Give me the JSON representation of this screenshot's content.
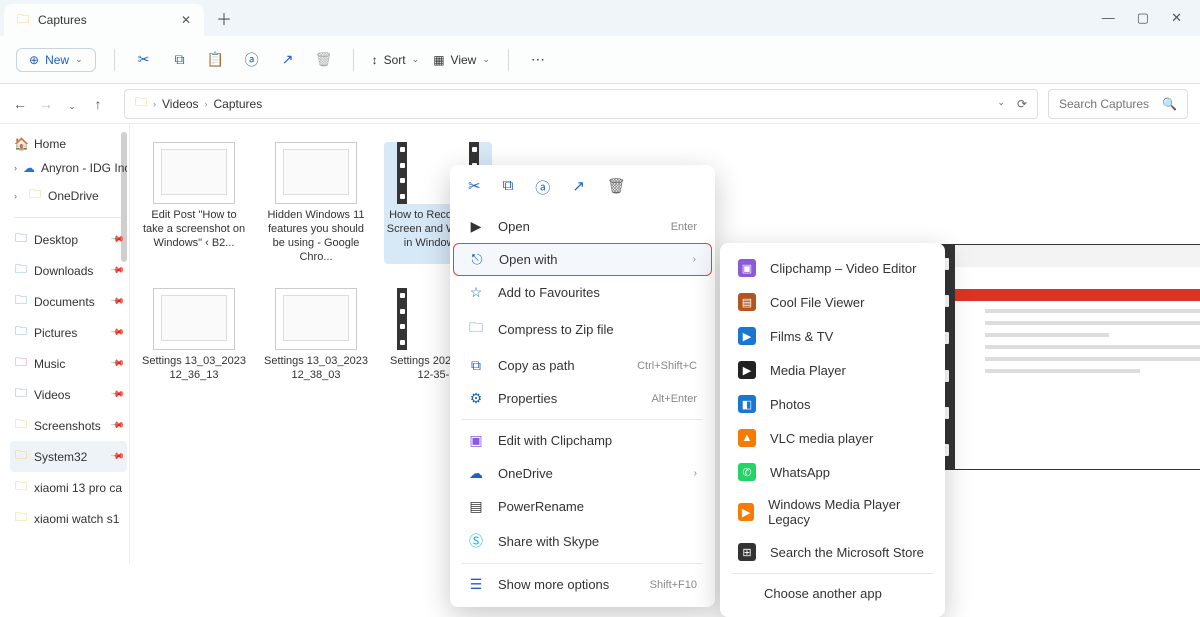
{
  "titlebar": {
    "tab_title": "Captures"
  },
  "toolbar": {
    "new_label": "New",
    "sort_label": "Sort",
    "view_label": "View"
  },
  "breadcrumbs": [
    "Videos",
    "Captures"
  ],
  "search": {
    "placeholder": "Search Captures"
  },
  "sidebar": {
    "home": "Home",
    "cloud": "Anyron - IDG Inc",
    "onedrive": "OneDrive",
    "quick": [
      {
        "label": "Desktop",
        "color": "#3a86d0"
      },
      {
        "label": "Downloads",
        "color": "#3a86d0"
      },
      {
        "label": "Documents",
        "color": "#3a86d0"
      },
      {
        "label": "Pictures",
        "color": "#3a86d0"
      },
      {
        "label": "Music",
        "color": "#d04a6f"
      },
      {
        "label": "Videos",
        "color": "#3a86d0"
      },
      {
        "label": "Screenshots",
        "color": "#f0b429"
      },
      {
        "label": "System32",
        "color": "#f0b429"
      },
      {
        "label": "xiaomi 13 pro ca",
        "color": "#f0b429"
      },
      {
        "label": "xiaomi watch s1",
        "color": "#f0b429"
      }
    ]
  },
  "files": {
    "row1": [
      {
        "name": "Edit Post \"How to take a screenshot on Windows\" ‹ B2...",
        "video": false
      },
      {
        "name": "Hidden Windows 11 features you should be using - Google Chro...",
        "video": false
      },
      {
        "name": "How to Record Your Screen and Webcam in Windows ...",
        "video": true
      }
    ],
    "row2": [
      {
        "name": "Settings 13_03_2023 12_36_13",
        "video": false
      },
      {
        "name": "Settings 13_03_2023 12_38_03",
        "video": false
      },
      {
        "name": "Settings 2023-03-... 12-35-...",
        "video": true
      }
    ]
  },
  "context_menu": {
    "open": "Open",
    "open_short": "Enter",
    "open_with": "Open with",
    "favourites": "Add to Favourites",
    "zip": "Compress to Zip file",
    "copy_path": "Copy as path",
    "copy_path_short": "Ctrl+Shift+C",
    "properties": "Properties",
    "properties_short": "Alt+Enter",
    "clipchamp": "Edit with Clipchamp",
    "onedrive": "OneDrive",
    "powerrename": "PowerRename",
    "skype": "Share with Skype",
    "more": "Show more options",
    "more_short": "Shift+F10"
  },
  "open_with_apps": [
    {
      "label": "Clipchamp – Video Editor",
      "bg": "#8b5ad6",
      "glyph": "▣"
    },
    {
      "label": "Cool File Viewer",
      "bg": "#b3551c",
      "glyph": "▤"
    },
    {
      "label": "Films & TV",
      "bg": "#1976d2",
      "glyph": "▶"
    },
    {
      "label": "Media Player",
      "bg": "#222",
      "glyph": "▶"
    },
    {
      "label": "Photos",
      "bg": "#1976d2",
      "glyph": "◧"
    },
    {
      "label": "VLC media player",
      "bg": "#f57c00",
      "glyph": "▲"
    },
    {
      "label": "WhatsApp",
      "bg": "#25d366",
      "glyph": "✆"
    },
    {
      "label": "Windows Media Player Legacy",
      "bg": "#f57c00",
      "glyph": "▶"
    },
    {
      "label": "Search the Microsoft Store",
      "bg": "#333",
      "glyph": "⊞"
    }
  ],
  "open_with_choose": "Choose another app"
}
